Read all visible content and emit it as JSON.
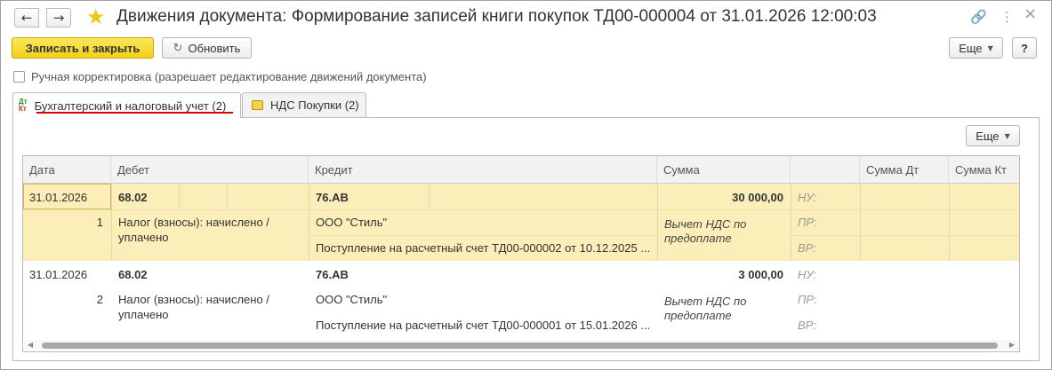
{
  "window": {
    "title": "Движения документа: Формирование записей книги покупок ТД00-000004 от 31.01.2026 12:00:03",
    "back_icon": "←",
    "forward_icon": "→",
    "star_icon": "★",
    "link_icon": "🔗",
    "more_icon": "⋮",
    "close_icon": "×"
  },
  "toolbar": {
    "save_close_label": "Записать и закрыть",
    "refresh_label": "Обновить",
    "refresh_icon": "↻",
    "more_label": "Еще",
    "help_label": "?"
  },
  "manual_correction": {
    "label": "Ручная корректировка (разрешает редактирование движений документа)",
    "checked": false
  },
  "tabs": [
    {
      "label": "Бухгалтерский и налоговый учет (2)",
      "icon": "dt-kt-icon",
      "active": true
    },
    {
      "label": "НДС Покупки (2)",
      "icon": "nds-icon",
      "active": false
    }
  ],
  "dtkt": {
    "dt": "Дт",
    "kt": "Кт"
  },
  "panel": {
    "more_label": "Еще"
  },
  "grid": {
    "columns": [
      "Дата",
      "Дебет",
      "Кредит",
      "Сумма",
      "",
      "Сумма Дт",
      "Сумма Кт"
    ],
    "rows": [
      {
        "date": "31.01.2026",
        "number": "1",
        "debit_account": "68.02",
        "debit_sub1": "Налог (взносы): начислено /",
        "debit_sub2": "уплачено",
        "credit_account": "76.АВ",
        "credit_sub1": "ООО \"Стиль\"",
        "credit_sub2": "Поступление на расчетный счет ТД00-000002 от 10.12.2025 ...",
        "amount": "30 000,00",
        "content1": "Вычет НДС по",
        "content2": "предоплате",
        "nu": "НУ:",
        "pr": "ПР:",
        "vr": "ВР:",
        "selected": true
      },
      {
        "date": "31.01.2026",
        "number": "2",
        "debit_account": "68.02",
        "debit_sub1": "Налог (взносы): начислено /",
        "debit_sub2": "уплачено",
        "credit_account": "76.АВ",
        "credit_sub1": "ООО \"Стиль\"",
        "credit_sub2": "Поступление на расчетный счет ТД00-000001 от 15.01.2026 ...",
        "amount": "3 000,00",
        "content1": "Вычет НДС по",
        "content2": "предоплате",
        "nu": "НУ:",
        "pr": "ПР:",
        "vr": "ВР:",
        "selected": false
      }
    ]
  },
  "scrollbar": {
    "left_arrow": "◀",
    "right_arrow": "▶"
  }
}
